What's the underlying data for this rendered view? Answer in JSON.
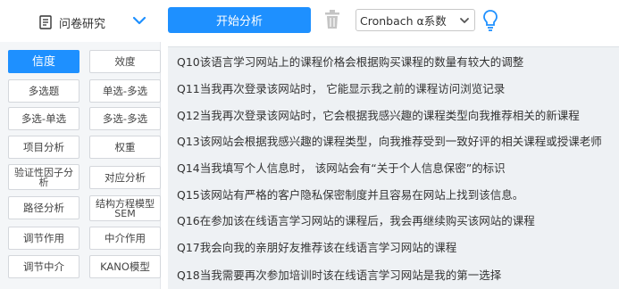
{
  "header": {
    "survey_label": "问卷研究",
    "start_button": "开始分析",
    "method_select_value": "Cronbach α系数",
    "accent_color": "#1e90ff",
    "icons": [
      "document-icon",
      "chevron-down-icon",
      "trash-icon",
      "select-caret-icon",
      "lightbulb-icon"
    ]
  },
  "sidebar": {
    "items": [
      {
        "label": "信度",
        "active": true
      },
      {
        "label": "效度"
      },
      {
        "label": "多选题"
      },
      {
        "label": "单选-多选"
      },
      {
        "label": "多选-单选"
      },
      {
        "label": "多选-多选"
      },
      {
        "label": "项目分析"
      },
      {
        "label": "权重"
      },
      {
        "label": "验证性因子分析"
      },
      {
        "label": "对应分析"
      },
      {
        "label": "路径分析"
      },
      {
        "label": "结构方程模型SEM"
      },
      {
        "label": "调节作用"
      },
      {
        "label": "中介作用"
      },
      {
        "label": "调节中介"
      },
      {
        "label": "KANO模型"
      }
    ]
  },
  "questions": [
    "Q10该语言学习网站上的课程价格会根据购买课程的数量有较大的调整",
    "Q11当我再次登录该网站时， 它能显示我之前的课程访问浏览记录",
    "Q12当我再次登录该网站时，它会根据我感兴趣的课程类型向我推荐相关的新课程",
    "Q13该网站会根据我感兴趣的课程类型，向我推荐受到一致好评的相关课程或授课老师",
    "Q14当我填写个人信息时， 该网站会有“关于个人信息保密”的标识",
    "Q15该网站有严格的客户隐私保密制度并且容易在网站上找到该信息。",
    "Q16在参加该在线语言学习网站的课程后，我会再继续购买该网站的课程",
    "Q17我会向我的亲朋好友推荐该在线语言学习网站的课程",
    "Q18当我需要再次参加培训时该在线语言学习网站是我的第一选择"
  ]
}
